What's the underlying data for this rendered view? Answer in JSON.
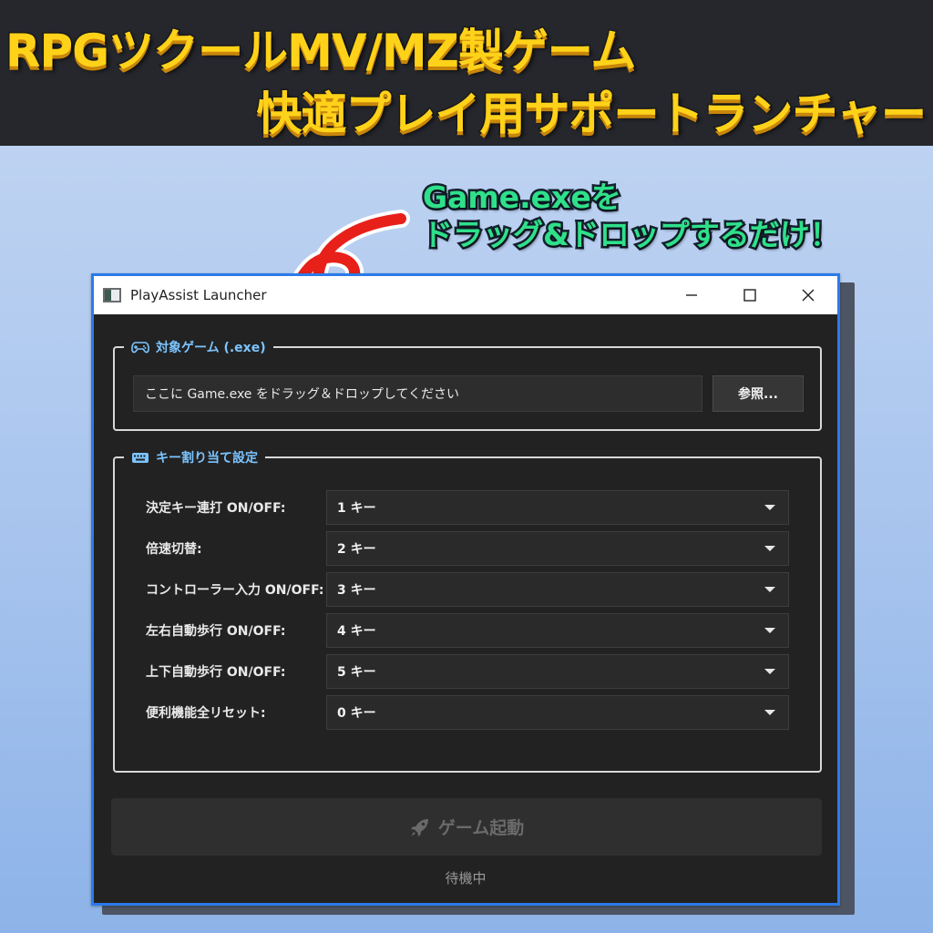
{
  "banner": {
    "line1": "RPGツクールMV/MZ製ゲーム",
    "line2": "快適プレイ用サポートランチャー"
  },
  "callout": {
    "line1": "Game.exeを",
    "line2": "ドラッグ&ドロップするだけ！"
  },
  "window": {
    "title": "PlayAssist Launcher",
    "controls": [
      "minimize-icon",
      "maximize-icon",
      "close-icon"
    ]
  },
  "target_group": {
    "label": "対象ゲーム (.exe)",
    "icon": "gamepad-icon",
    "input_text": "ここに Game.exe をドラッグ＆ドロップしてください",
    "browse_label": "参照..."
  },
  "keys_group": {
    "label": "キー割り当て設定",
    "icon": "keyboard-icon",
    "rows": [
      {
        "label": "決定キー連打 ON/OFF:",
        "value": "1 キー"
      },
      {
        "label": "倍速切替:",
        "value": "2 キー"
      },
      {
        "label": "コントローラー入力 ON/OFF:",
        "value": "3 キー"
      },
      {
        "label": "左右自動歩行 ON/OFF:",
        "value": "4 キー"
      },
      {
        "label": "上下自動歩行 ON/OFF:",
        "value": "5 キー"
      },
      {
        "label": "便利機能全リセット:",
        "value": "0 キー"
      }
    ]
  },
  "launch": {
    "label": "ゲーム起動",
    "icon": "rocket-icon",
    "enabled": false
  },
  "status": "待機中",
  "colors": {
    "accent_border": "#2b7bea",
    "legend_text": "#7cc4ff",
    "banner_text": "#ffd21a",
    "callout_text": "#2fe08a",
    "arrow": "#e8201a"
  }
}
